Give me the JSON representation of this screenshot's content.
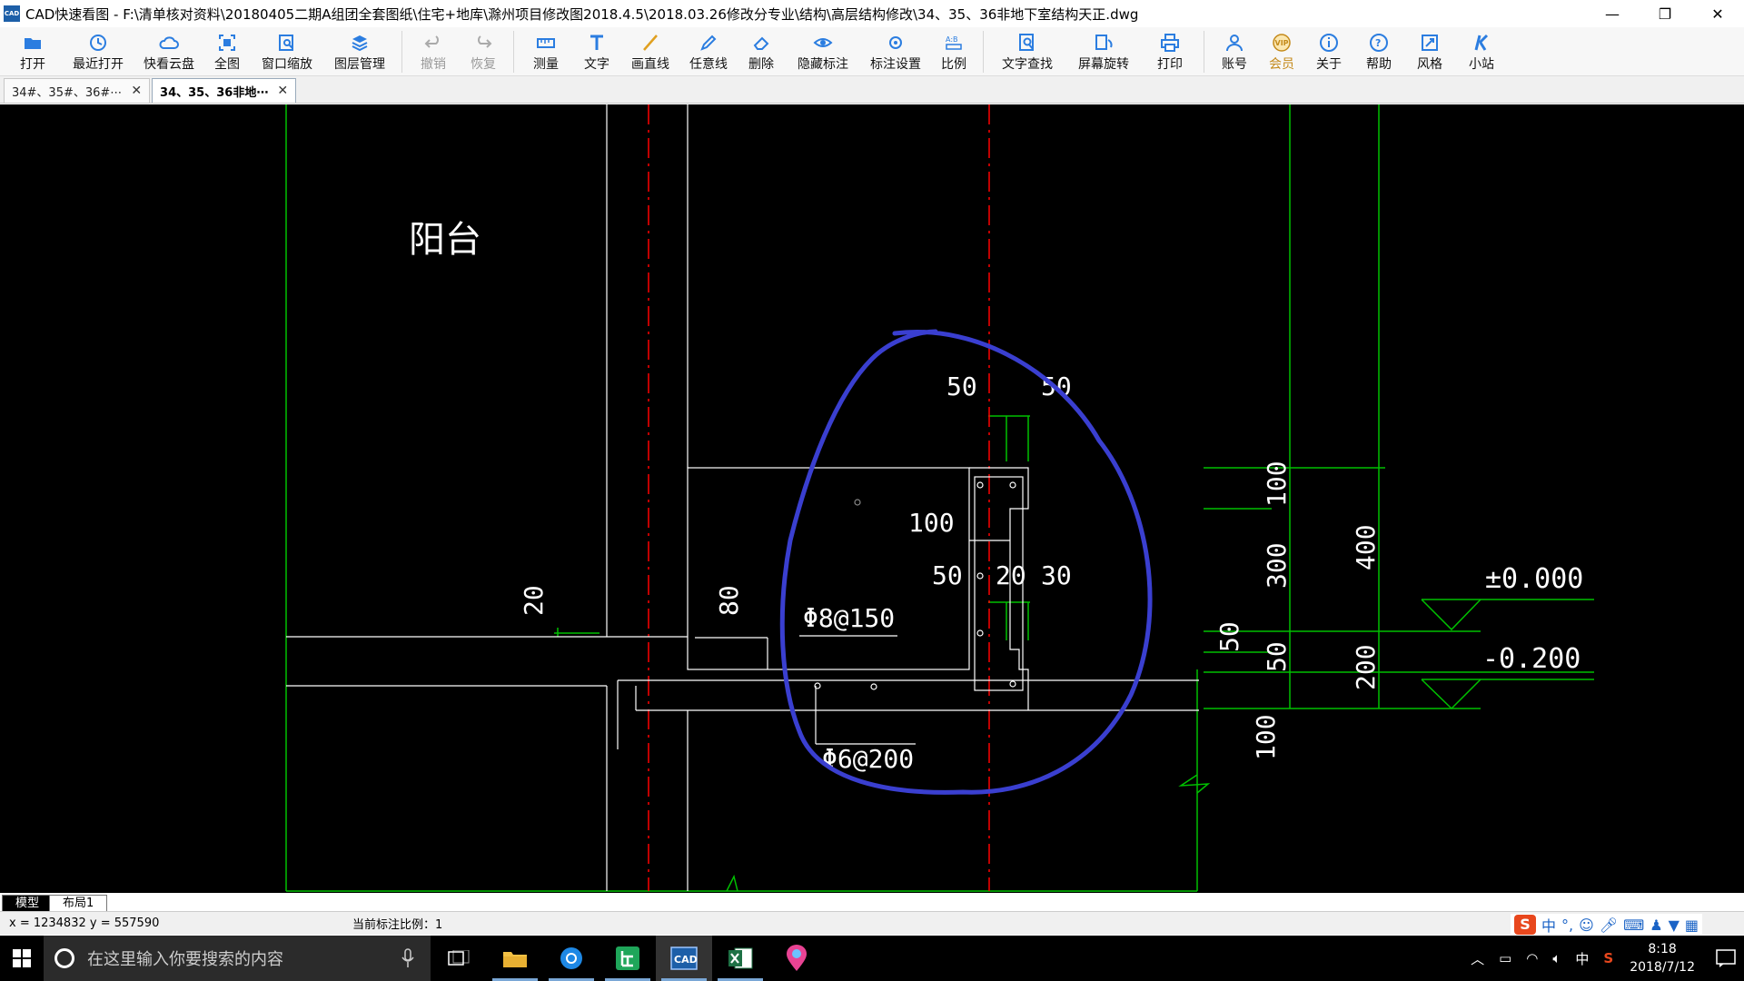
{
  "window": {
    "title": "CAD快速看图 - F:\\清单核对资料\\20180405二期A组团全套图纸\\住宅+地库\\滁州项目修改图2018.4.5\\2018.03.26修改分专业\\结构\\高层结构修改\\34、35、36非地下室结构天正.dwg",
    "app_icon_text": "CAD",
    "minimize": "—",
    "restore": "❐",
    "close": "✕"
  },
  "toolbar": {
    "items": [
      {
        "label": "打开",
        "icon": "folder-open-icon"
      },
      {
        "label": "最近打开",
        "icon": "history-icon"
      },
      {
        "label": "快看云盘",
        "icon": "cloud-icon"
      },
      {
        "label": "全图",
        "icon": "fit-view-icon"
      },
      {
        "label": "窗口缩放",
        "icon": "zoom-window-icon"
      },
      {
        "label": "图层管理",
        "icon": "layers-icon"
      },
      {
        "label": "撤销",
        "icon": "undo-icon",
        "disabled": true
      },
      {
        "label": "恢复",
        "icon": "redo-icon",
        "disabled": true
      },
      {
        "label": "测量",
        "icon": "measure-icon"
      },
      {
        "label": "文字",
        "icon": "text-icon"
      },
      {
        "label": "画直线",
        "icon": "line-icon"
      },
      {
        "label": "任意线",
        "icon": "pen-icon"
      },
      {
        "label": "删除",
        "icon": "eraser-icon"
      },
      {
        "label": "隐藏标注",
        "icon": "eye-icon"
      },
      {
        "label": "标注设置",
        "icon": "dim-settings-icon"
      },
      {
        "label": "比例",
        "icon": "scale-icon"
      },
      {
        "label": "文字查找",
        "icon": "text-search-icon"
      },
      {
        "label": "屏幕旋转",
        "icon": "rotate-screen-icon"
      },
      {
        "label": "打印",
        "icon": "print-icon"
      },
      {
        "label": "账号",
        "icon": "user-icon"
      },
      {
        "label": "会员",
        "icon": "vip-icon",
        "vip": true
      },
      {
        "label": "关于",
        "icon": "info-icon"
      },
      {
        "label": "帮助",
        "icon": "help-icon"
      },
      {
        "label": "风格",
        "icon": "style-icon"
      },
      {
        "label": "小站",
        "icon": "station-icon"
      }
    ]
  },
  "doc_tabs": [
    {
      "label": "34#、35#、36#⋯",
      "active": false
    },
    {
      "label": "34、35、36非地⋯",
      "active": true
    }
  ],
  "drawing": {
    "texts": {
      "balcony": "阳台",
      "d50a": "50",
      "d50b": "50",
      "d100": "100",
      "d50c": "50",
      "d20": "20",
      "d30": "30",
      "d20left": "20",
      "d80": "80",
      "rebar1": "Φ8@150",
      "rebar2": "Φ6@200",
      "v100a": "100",
      "v300": "300",
      "v400": "400",
      "v50a": "50",
      "v50b": "50",
      "v200": "200",
      "v100b": "100",
      "elev0": "±0.000",
      "elev1": "-0.200"
    }
  },
  "layout_tabs": [
    {
      "label": "模型",
      "active": true
    },
    {
      "label": "布局1",
      "active": false
    }
  ],
  "status": {
    "coords": "x = 1234832  y = 557590",
    "scale": "当前标注比例：1"
  },
  "taskbar": {
    "search_placeholder": "在这里输入你要搜索的内容",
    "tray_ime": "中",
    "time": "8:18",
    "date": "2018/7/12"
  },
  "colors": {
    "canvas_bg": "#000000",
    "green_line": "#00c000",
    "red_axis": "#ff0000",
    "white_line": "#ffffff",
    "annotation_blue": "#3a3fd0"
  }
}
